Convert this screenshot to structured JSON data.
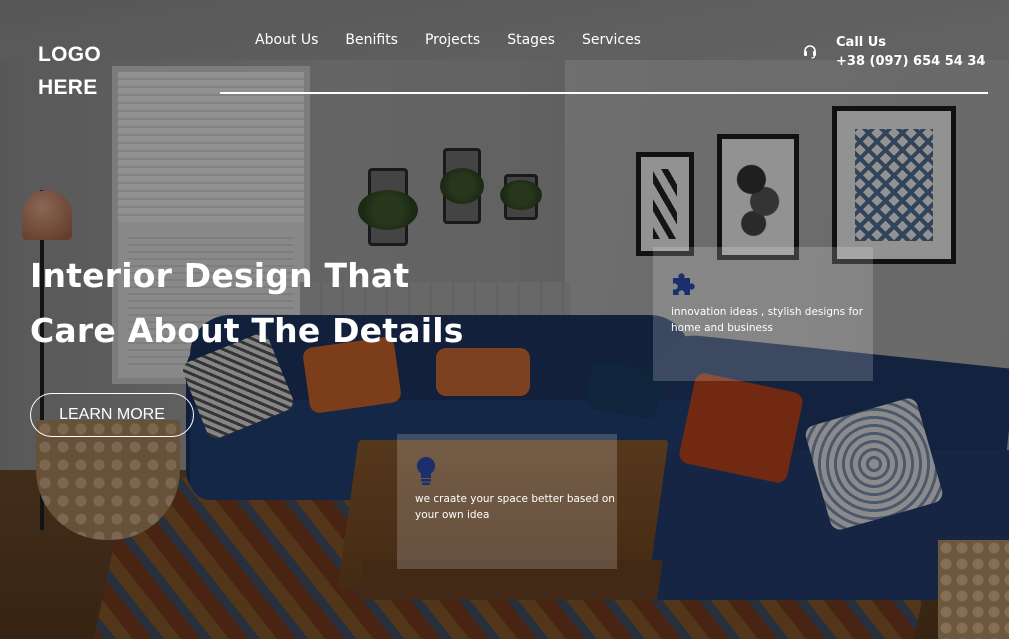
{
  "brand": {
    "logo_line1": "LOGO",
    "logo_line2": "HERE"
  },
  "nav": {
    "items": [
      {
        "label": "About Us"
      },
      {
        "label": "Benifits"
      },
      {
        "label": "Projects"
      },
      {
        "label": "Stages"
      },
      {
        "label": "Services"
      }
    ]
  },
  "contact": {
    "icon": "headset-icon",
    "label": "Call Us",
    "phone": "+38 (097) 654 54 34"
  },
  "hero": {
    "line1": "Interior Design That",
    "line2": "Care About The Details",
    "cta_label": "LEARN MORE"
  },
  "cards": [
    {
      "icon": "puzzle-icon",
      "text": "innovation ideas , stylish designs for home and business"
    },
    {
      "icon": "lightbulb-icon",
      "text": "we craate your space better based on your own idea"
    }
  ],
  "colors": {
    "accent": "#1a2f6b",
    "overlay": "#000000",
    "text": "#ffffff"
  }
}
